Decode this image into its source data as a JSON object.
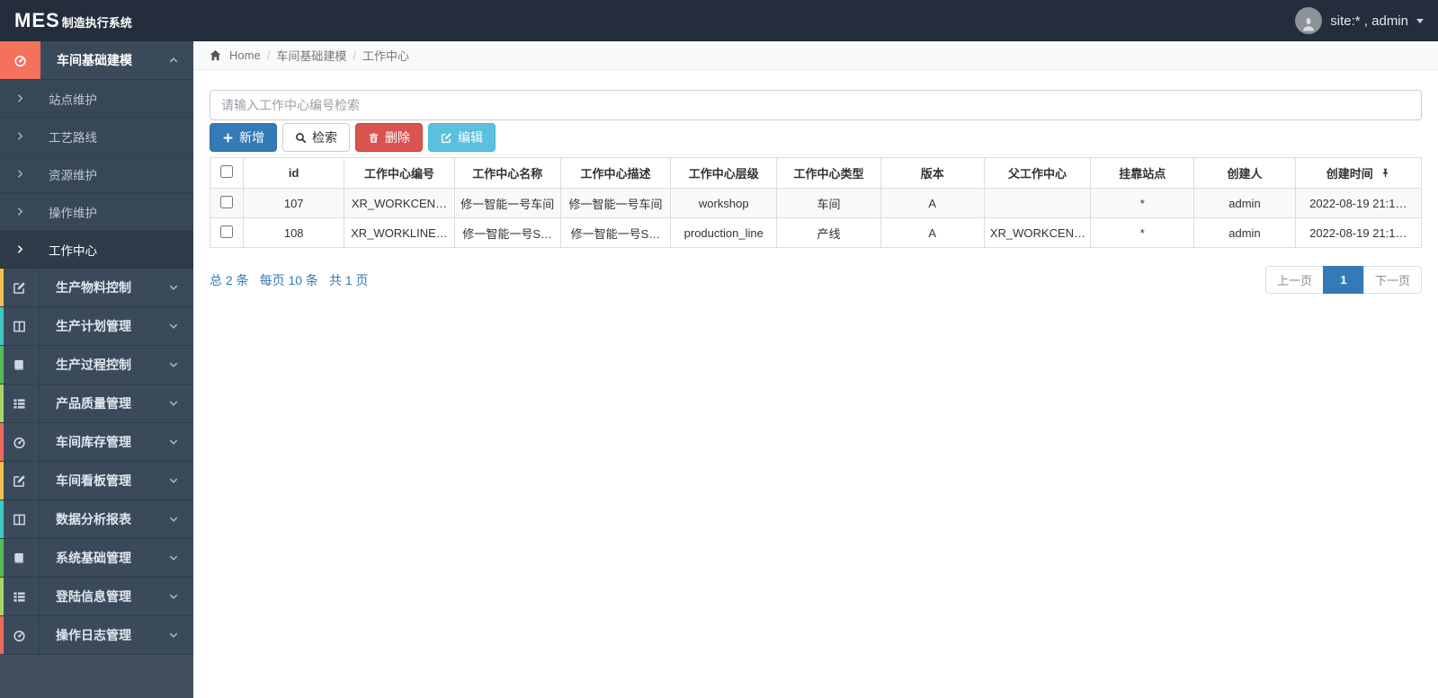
{
  "app": {
    "brand_bold": "MES",
    "brand_rest": "制造执行系统",
    "user_label": "site:* , admin"
  },
  "breadcrumb": {
    "home": "Home",
    "separator": "/",
    "section": "车间基础建模",
    "current": "工作中心"
  },
  "sidebar": {
    "groups": [
      {
        "label": "车间基础建模",
        "icon": "dashboard-icon",
        "expanded": true
      },
      {
        "label": "生产物料控制",
        "icon": "pencil-square-icon"
      },
      {
        "label": "生产计划管理",
        "icon": "columns-icon"
      },
      {
        "label": "生产过程控制",
        "icon": "book-icon"
      },
      {
        "label": "产品质量管理",
        "icon": "list-icon"
      },
      {
        "label": "车间库存管理",
        "icon": "dashboard-icon"
      },
      {
        "label": "车间看板管理",
        "icon": "pencil-square-icon"
      },
      {
        "label": "数据分析报表",
        "icon": "columns-icon"
      },
      {
        "label": "系统基础管理",
        "icon": "book-icon"
      },
      {
        "label": "登陆信息管理",
        "icon": "list-icon"
      },
      {
        "label": "操作日志管理",
        "icon": "dashboard-icon"
      }
    ],
    "sub_items": [
      "站点维护",
      "工艺路线",
      "资源维护",
      "操作维护",
      "工作中心"
    ],
    "active_sub_item": "工作中心",
    "strip_colors": [
      "#f0c24b",
      "#3fc8c4",
      "#5cb85c",
      "#a8d468",
      "#ed6a5e"
    ],
    "active_group_icon_bg": "#f4715c"
  },
  "toolbar": {
    "search_placeholder": "请输入工作中心编号检索",
    "search_value": "",
    "add_label": "新增",
    "query_label": "检索",
    "delete_label": "删除",
    "edit_label": "编辑"
  },
  "table": {
    "columns": [
      "id",
      "工作中心编号",
      "工作中心名称",
      "工作中心描述",
      "工作中心层级",
      "工作中心类型",
      "版本",
      "父工作中心",
      "挂靠站点",
      "创建人",
      "创建时间"
    ],
    "rows": [
      {
        "id": "107",
        "code": "XR_WORKCEN…",
        "name": "修一智能一号车间",
        "desc": "修一智能一号车间",
        "level": "workshop",
        "type": "车间",
        "version": "A",
        "parent": "",
        "station": "*",
        "creator": "admin",
        "created": "2022-08-19 21:1…"
      },
      {
        "id": "108",
        "code": "XR_WORKLINE…",
        "name": "修一智能一号S…",
        "desc": "修一智能一号S…",
        "level": "production_line",
        "type": "产线",
        "version": "A",
        "parent": "XR_WORKCEN…",
        "station": "*",
        "creator": "admin",
        "created": "2022-08-19 21:1…"
      }
    ]
  },
  "pagination": {
    "total_label": "总 2 条",
    "per_page_label": "每页 10 条",
    "pages_label": "共 1 页",
    "prev_label": "上一页",
    "current_page": "1",
    "next_label": "下一页"
  },
  "colors": {
    "navbar_bg": "#232d3b",
    "sidebar_bg": "#3b4a5b",
    "accent_blue": "#337ab7",
    "danger_red": "#d9534f",
    "info_blue": "#5bc0de",
    "active_group_bg": "#f4715c",
    "table_border": "#dddddd",
    "stripe_row": "#f9f9f9"
  },
  "icons": {
    "brand_area": [],
    "used": [
      "home-icon",
      "dashboard-icon",
      "pencil-square-icon",
      "columns-icon",
      "book-icon",
      "list-icon",
      "chevron-up-icon",
      "chevron-down-icon",
      "chevron-right-icon",
      "plus-icon",
      "search-icon",
      "trash-icon",
      "edit-icon",
      "pin-icon",
      "caret-down-icon",
      "user-avatar-icon"
    ]
  }
}
